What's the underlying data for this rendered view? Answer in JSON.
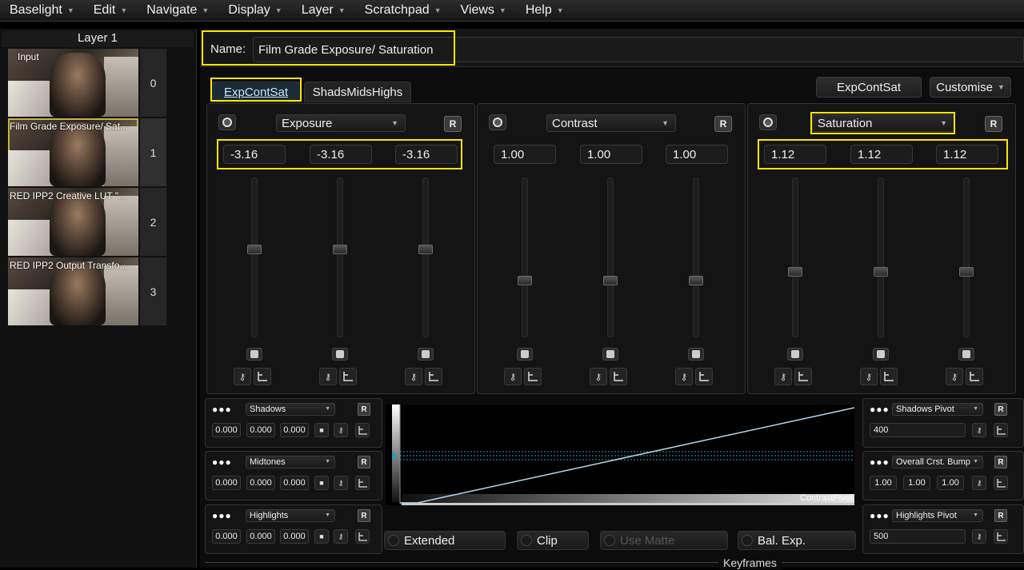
{
  "menubar": {
    "items": [
      "Baselight",
      "Edit",
      "Navigate",
      "Display",
      "Layer",
      "Scratchpad",
      "Views",
      "Help"
    ]
  },
  "layers": {
    "title": "Layer 1",
    "rows": [
      {
        "label": "Input",
        "number": "0"
      },
      {
        "label": "Film Grade Exposure/ Sat...",
        "number": "1"
      },
      {
        "label": "RED IPP2 Creative LUT \"...",
        "number": "2"
      },
      {
        "label": "RED IPP2 Output Transfo...",
        "number": "3"
      }
    ]
  },
  "name_bar": {
    "label": "Name:",
    "value": "Film Grade Exposure/ Saturation"
  },
  "tabs": [
    "ExpContSat",
    "ShadsMidsHighs"
  ],
  "top_right": {
    "preset": "ExpContSat",
    "customise": "Customise"
  },
  "panels": [
    {
      "title": "Exposure",
      "r_label": "R",
      "values": [
        "-3.16",
        "-3.16",
        "-3.16"
      ],
      "slider_levels": [
        0.56,
        0.56,
        0.56
      ]
    },
    {
      "title": "Contrast",
      "r_label": "R",
      "values": [
        "1.00",
        "1.00",
        "1.00"
      ],
      "slider_levels": [
        0.35,
        0.35,
        0.35
      ]
    },
    {
      "title": "Saturation",
      "r_label": "R",
      "values": [
        "1.12",
        "1.12",
        "1.12"
      ],
      "slider_levels": [
        0.41,
        0.41,
        0.41
      ]
    }
  ],
  "small_panels_left": [
    {
      "title": "Shadows",
      "r_label": "R",
      "values": [
        "0.000",
        "0.000",
        "0.000"
      ]
    },
    {
      "title": "Midtones",
      "r_label": "R",
      "values": [
        "0.000",
        "0.000",
        "0.000"
      ]
    },
    {
      "title": "Highlights",
      "r_label": "R",
      "values": [
        "0.000",
        "0.000",
        "0.000"
      ]
    }
  ],
  "small_panels_right": [
    {
      "title": "Shadows Pivot",
      "r_label": "R",
      "value": "400"
    },
    {
      "title": "Overall Crst. Bump",
      "r_label": "R",
      "values": [
        "1.00",
        "1.00",
        "1.00"
      ]
    },
    {
      "title": "Highlights Pivot",
      "r_label": "R",
      "value": "500"
    }
  ],
  "curve": {
    "label": "ContrastPivot"
  },
  "bottom_buttons": [
    "Extended",
    "Clip",
    "Use Matte",
    "Bal. Exp."
  ],
  "keyframes_label": "Keyframes",
  "colors": {
    "highlight": "#ffe600",
    "curve": "#b8d8ec",
    "guide": "#2a9fb0"
  }
}
